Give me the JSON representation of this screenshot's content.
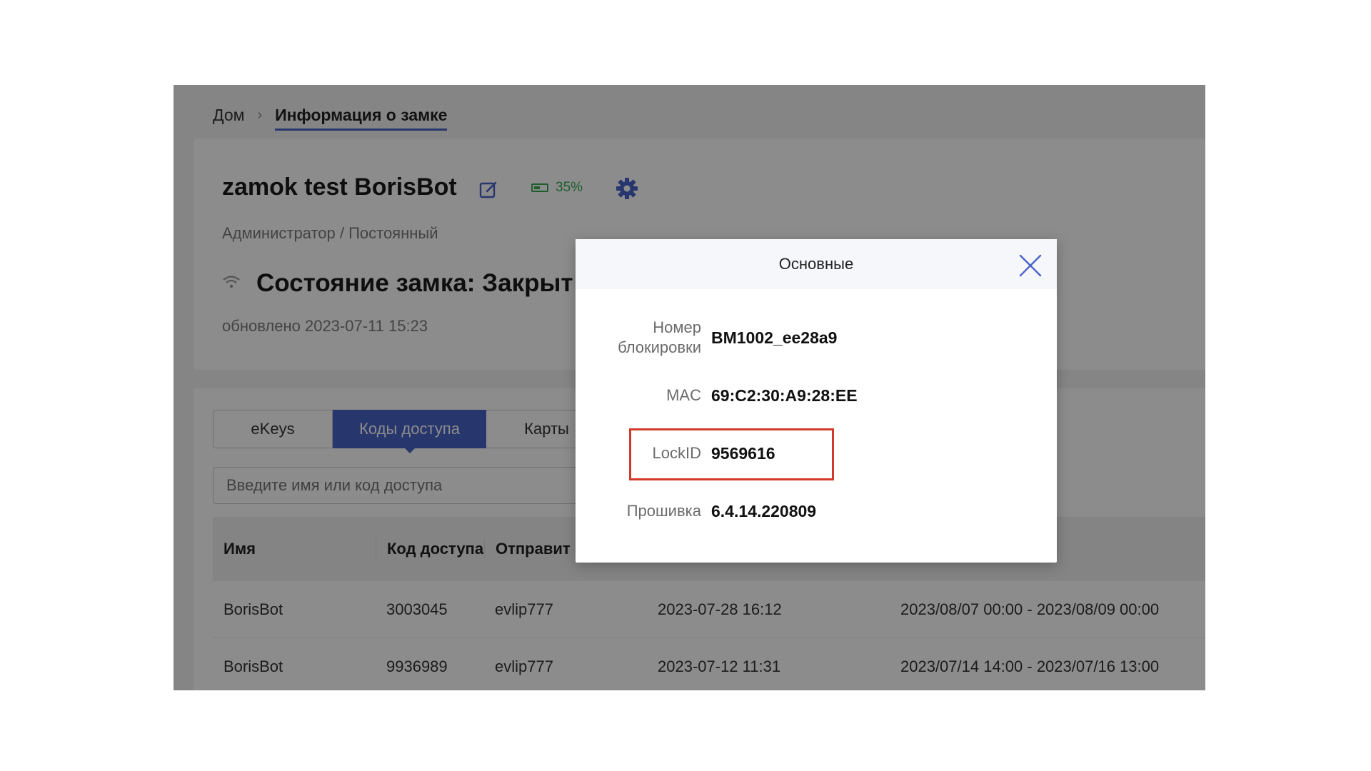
{
  "breadcrumb": {
    "home": "Дом",
    "separator": "›",
    "current": "Информация о замке"
  },
  "lock": {
    "name": "zamok test BorisBot",
    "battery": "35%",
    "role": "Администратор / Постоянный",
    "state": "Состояние замка: Закрыт",
    "updated": "обновлено 2023-07-11 15:23"
  },
  "tabs": [
    "eKeys",
    "Коды доступа",
    "Карты"
  ],
  "search": {
    "placeholder": "Введите имя или код доступа"
  },
  "table": {
    "headers": [
      "Имя",
      "Код доступа",
      "Отправит"
    ],
    "rows": [
      [
        "BorisBot",
        "3003045",
        "evlip777",
        "2023-07-28 16:12",
        "2023/08/07 00:00 - 2023/08/09 00:00"
      ],
      [
        "BorisBot",
        "9936989",
        "evlip777",
        "2023-07-12 11:31",
        "2023/07/14 14:00 - 2023/07/16 13:00"
      ]
    ]
  },
  "modal": {
    "title": "Основные",
    "fields": [
      {
        "label": "Номер блокировки",
        "value": "BM1002_ee28a9"
      },
      {
        "label": "MAC",
        "value": "69:C2:30:A9:28:EE"
      },
      {
        "label": "LockID",
        "value": "9569616"
      },
      {
        "label": "Прошивка",
        "value": "6.4.14.220809"
      }
    ]
  },
  "colors": {
    "accent": "#4a63c9",
    "battery": "#3aa957",
    "highlight": "#d23a2a"
  },
  "icons": [
    "edit-icon",
    "battery-icon",
    "gear-icon",
    "wifi-icon",
    "close-icon"
  ]
}
